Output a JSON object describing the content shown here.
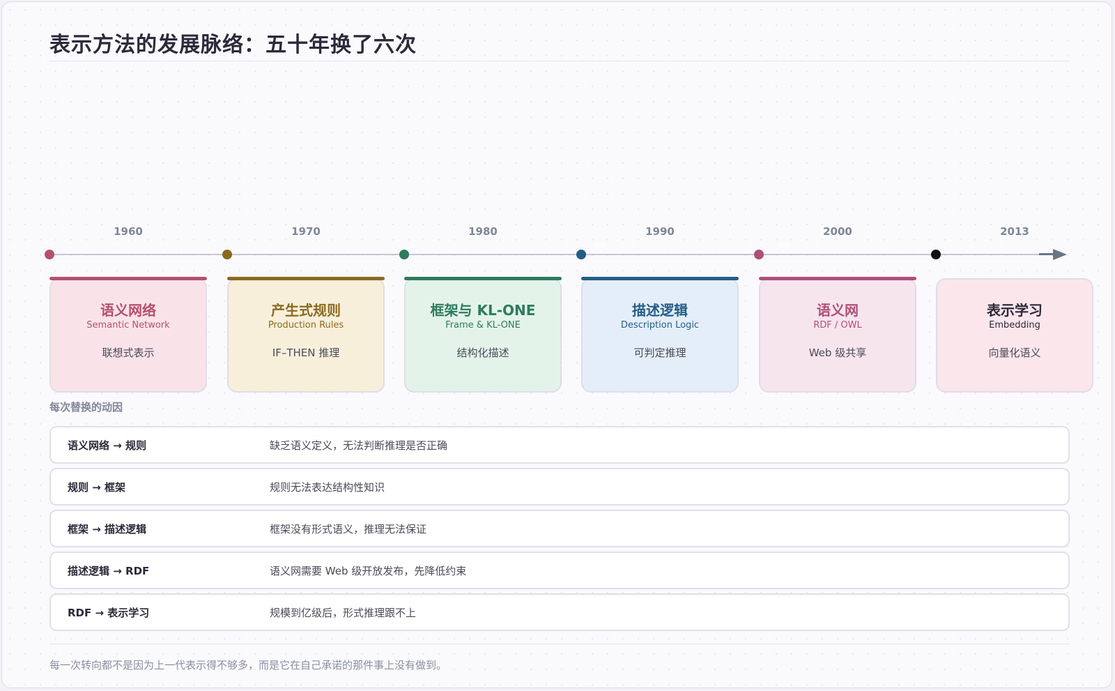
{
  "title": "表示方法的发展脉络：五十年换了六次",
  "timeline": [
    {
      "year": "1960",
      "name": "语义网络",
      "sub": "Semantic Network",
      "desc": "联想式表示",
      "accent": "#b5506f",
      "bg": "#f9e3e9"
    },
    {
      "year": "1970",
      "name": "产生式规则",
      "sub": "Production Rules",
      "desc": "IF–THEN 推理",
      "accent": "#8a6a1f",
      "bg": "#f8efdb"
    },
    {
      "year": "1980",
      "name": "框架与 KL-ONE",
      "sub": "Frame & KL-ONE",
      "desc": "结构化描述",
      "accent": "#2e7b5d",
      "bg": "#e3f3ea"
    },
    {
      "year": "1990",
      "name": "描述逻辑",
      "sub": "Description Logic",
      "desc": "可判定推理",
      "accent": "#255d87",
      "bg": "#e4eef8"
    },
    {
      "year": "2000",
      "name": "语义网",
      "sub": "RDF / OWL",
      "desc": "Web 级共享",
      "accent": "#b04f7a",
      "bg": "#f7e5ee"
    },
    {
      "year": "2013",
      "name": "表示学习",
      "sub": "Embedding",
      "desc": "向量化语义",
      "accent": "#111111",
      "bg": "#fbe6ec"
    }
  ],
  "reasons_label": "每次替换的动因",
  "reasons": [
    {
      "from": "语义网络 → 规则",
      "why": "缺乏语义定义，无法判断推理是否正确"
    },
    {
      "from": "规则 → 框架",
      "why": "规则无法表达结构性知识"
    },
    {
      "from": "框架 → 描述逻辑",
      "why": "框架没有形式语义，推理无法保证"
    },
    {
      "from": "描述逻辑 → RDF",
      "why": "语义网需要 Web 级开放发布，先降低约束"
    },
    {
      "from": "RDF → 表示学习",
      "why": "规模到亿级后，形式推理跟不上"
    }
  ],
  "footer": "每一次转向都不是因为上一代表示得不够多，而是它在自己承诺的那件事上没有做到。"
}
